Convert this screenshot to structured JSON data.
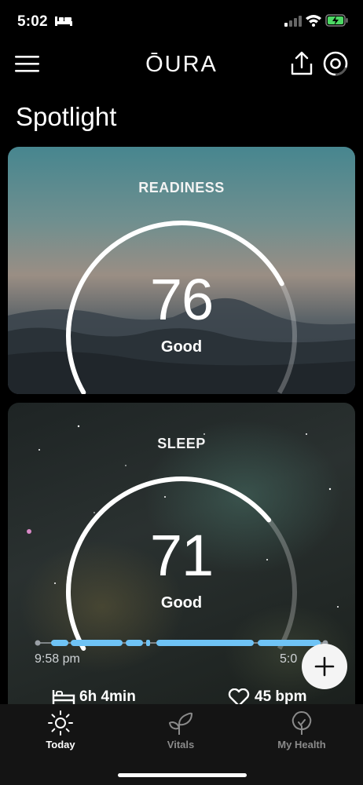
{
  "status_bar": {
    "time": "5:02"
  },
  "header": {
    "logo": "ŌURA"
  },
  "page_title": "Spotlight",
  "readiness": {
    "label": "READINESS",
    "score": "76",
    "description": "Good",
    "level": 0.76
  },
  "sleep": {
    "label": "SLEEP",
    "score": "71",
    "description": "Good",
    "level": 0.71,
    "start_time": "9:58 pm",
    "end_time": "5:0",
    "duration": "6h 4min",
    "heart_rate": "45 bpm"
  },
  "tabs": [
    {
      "label": "Today",
      "icon": "sun-icon",
      "active": true
    },
    {
      "label": "Vitals",
      "icon": "sprout-icon",
      "active": false
    },
    {
      "label": "My Health",
      "icon": "tree-icon",
      "active": false
    }
  ],
  "colors": {
    "accent_blue": "#6fc3f5",
    "tab_active": "#ffffff",
    "tab_inactive": "#8a8a8a"
  }
}
